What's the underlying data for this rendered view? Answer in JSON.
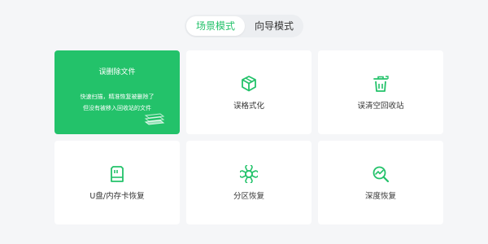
{
  "mode_tabs": [
    {
      "label": "场景模式",
      "active": true
    },
    {
      "label": "向导模式",
      "active": false
    }
  ],
  "cards": {
    "deleted_files": {
      "title": "误删除文件",
      "desc_line1": "快速扫描，精准恢复被删除了",
      "desc_line2": "但没有被移入回收站的文件"
    },
    "format": {
      "label": "误格式化",
      "icon": "cube-icon"
    },
    "recycle_bin": {
      "label": "误清空回收站",
      "icon": "trash-icon"
    },
    "usb_card": {
      "label": "U盘/内存卡恢复",
      "icon": "sd-card-icon"
    },
    "partition": {
      "label": "分区恢复",
      "icon": "partition-icon"
    },
    "deep": {
      "label": "深度恢复",
      "icon": "deep-scan-icon"
    }
  },
  "colors": {
    "accent": "#23c26a",
    "background": "#f5f6f8",
    "card": "#ffffff",
    "text": "#333333"
  }
}
